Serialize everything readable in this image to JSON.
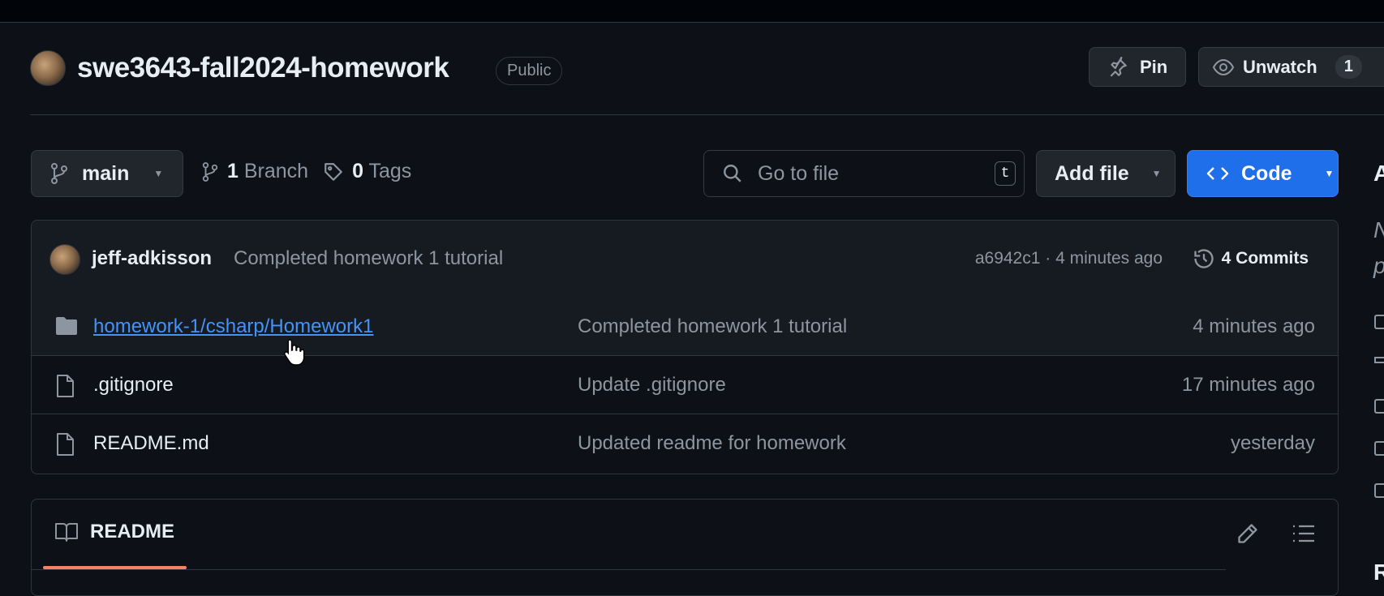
{
  "repo": {
    "name": "swe3643-fall2024-homework",
    "visibility": "Public"
  },
  "header_actions": {
    "pin_label": "Pin",
    "watch_label": "Unwatch",
    "watch_count": "1"
  },
  "toolbar": {
    "branch_name": "main",
    "branch_count": "1",
    "branch_label": "Branch",
    "tag_count": "0",
    "tag_label": "Tags",
    "search_placeholder": "Go to file",
    "search_shortcut": "t",
    "add_file_label": "Add file",
    "code_label": "Code"
  },
  "latest_commit": {
    "author": "jeff-adkisson",
    "message": "Completed homework 1 tutorial",
    "meta": "a6942c1 · 4 minutes ago",
    "commits_label": "4 Commits"
  },
  "files": [
    {
      "name": "homework-1/csharp/Homework1",
      "type": "folder",
      "message": "Completed homework 1 tutorial",
      "date": "4 minutes ago"
    },
    {
      "name": ".gitignore",
      "type": "file",
      "message": "Update .gitignore",
      "date": "17 minutes ago"
    },
    {
      "name": "README.md",
      "type": "file",
      "message": "Updated readme for homework",
      "date": "yesterday"
    }
  ],
  "readme": {
    "tab_label": "README"
  },
  "sidebar_fragments": {
    "first": "A",
    "second": "N",
    "third": "p",
    "bottom": "R"
  },
  "colors": {
    "background": "#0d1117",
    "accent_blue": "#1f6feb",
    "link_blue": "#4493f8",
    "tab_underline": "#f78166"
  }
}
